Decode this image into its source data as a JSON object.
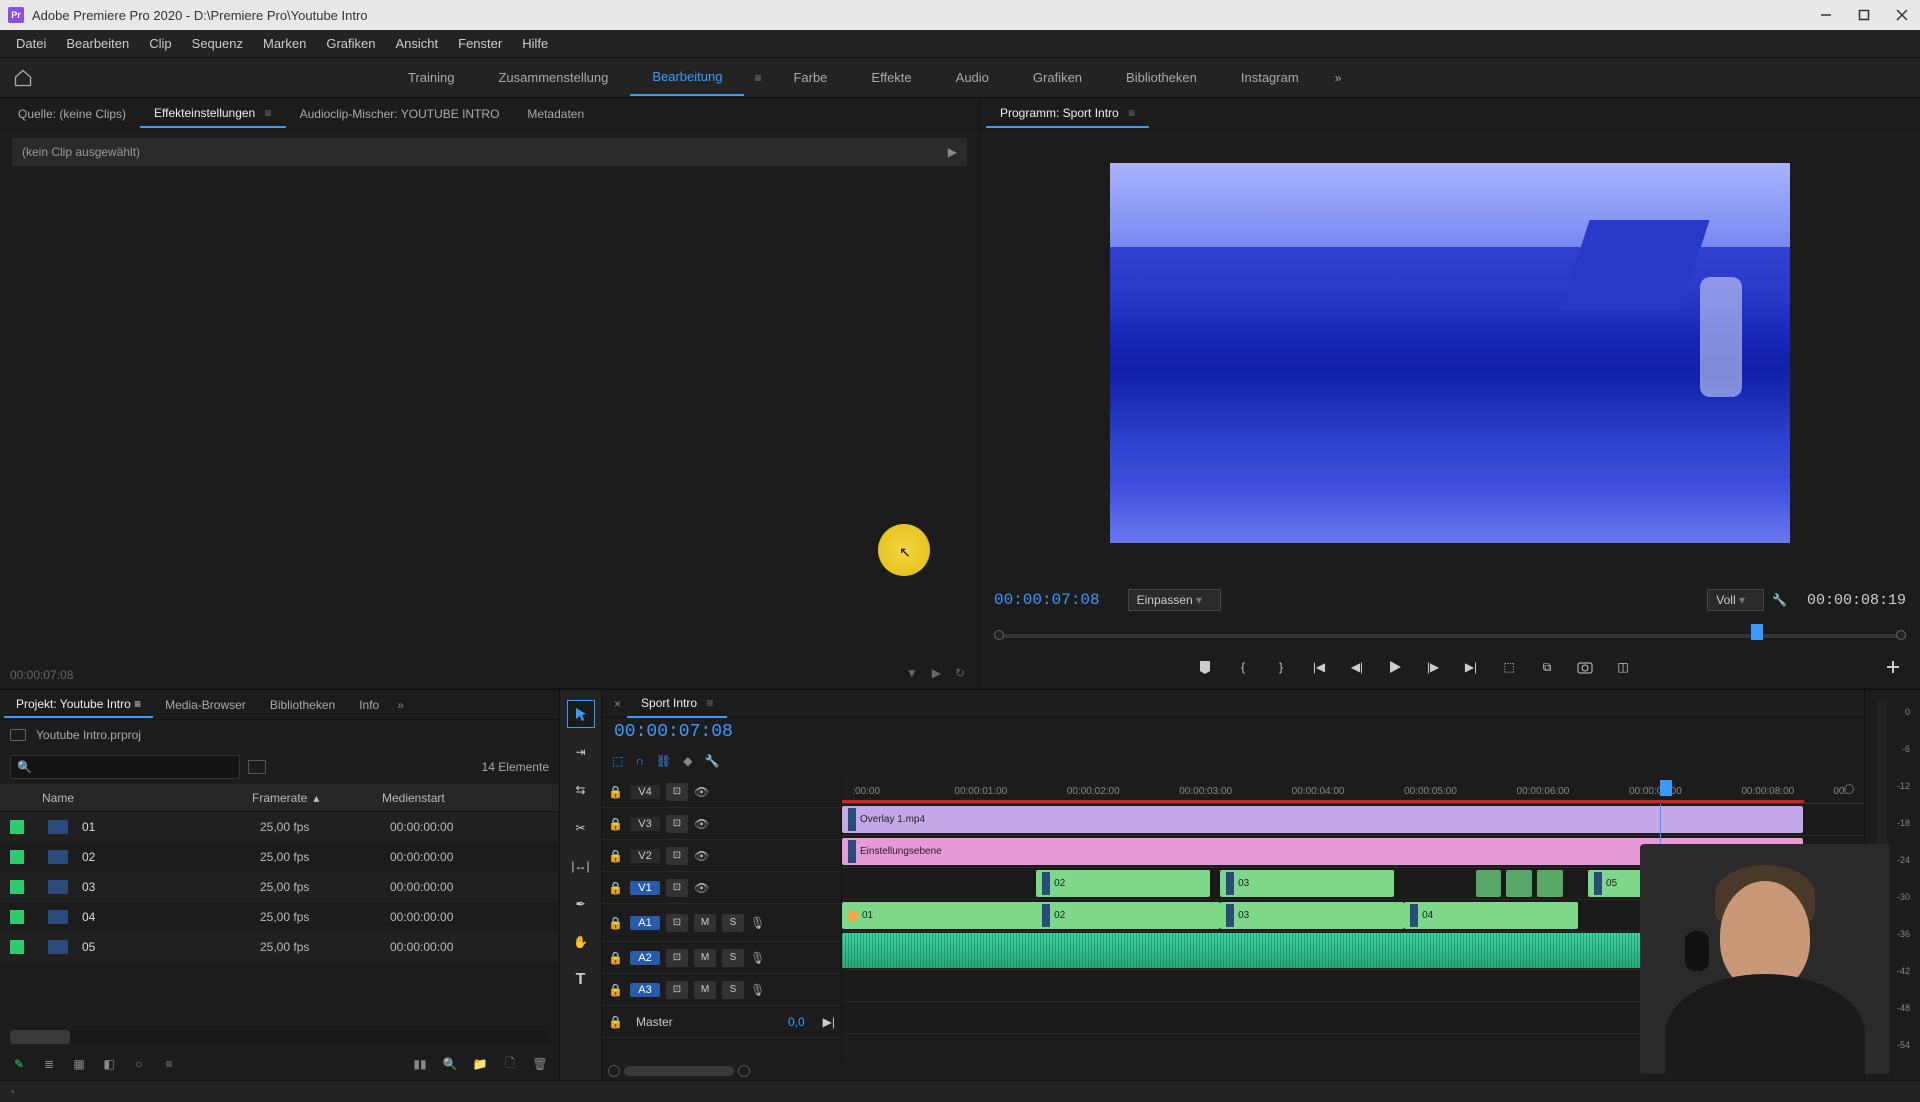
{
  "titlebar": {
    "app_initial": "Pr",
    "title": "Adobe Premiere Pro 2020 - D:\\Premiere Pro\\Youtube Intro"
  },
  "menubar": [
    "Datei",
    "Bearbeiten",
    "Clip",
    "Sequenz",
    "Marken",
    "Grafiken",
    "Ansicht",
    "Fenster",
    "Hilfe"
  ],
  "workspaces": {
    "items": [
      "Training",
      "Zusammenstellung",
      "Bearbeitung",
      "Farbe",
      "Effekte",
      "Audio",
      "Grafiken",
      "Bibliotheken",
      "Instagram"
    ],
    "active": "Bearbeitung"
  },
  "source_tabs": {
    "source": "Quelle: (keine Clips)",
    "effect": "Effekteinstellungen",
    "mixer": "Audioclip-Mischer: YOUTUBE INTRO",
    "meta": "Metadaten"
  },
  "effect_panel": {
    "no_clip": "(kein Clip ausgewählt)",
    "timecode": "00:00:07:08"
  },
  "program": {
    "tab": "Programm: Sport Intro",
    "timecode_left": "00:00:07:08",
    "fit": "Einpassen",
    "quality": "Voll",
    "timecode_right": "00:00:08:19"
  },
  "project": {
    "tabs": [
      "Projekt: Youtube Intro",
      "Media-Browser",
      "Bibliotheken",
      "Info"
    ],
    "name": "Youtube Intro.prproj",
    "count": "14 Elemente",
    "columns": {
      "name": "Name",
      "framerate": "Framerate",
      "mediastart": "Medienstart"
    },
    "rows": [
      {
        "name": "01",
        "fr": "25,00 fps",
        "ms": "00:00:00:00"
      },
      {
        "name": "02",
        "fr": "25,00 fps",
        "ms": "00:00:00:00"
      },
      {
        "name": "03",
        "fr": "25,00 fps",
        "ms": "00:00:00:00"
      },
      {
        "name": "04",
        "fr": "25,00 fps",
        "ms": "00:00:00:00"
      },
      {
        "name": "05",
        "fr": "25,00 fps",
        "ms": "00:00:00:00"
      }
    ]
  },
  "timeline": {
    "tab": "Sport Intro",
    "timecode": "00:00:07:08",
    "ruler": [
      ":00:00",
      "00:00:01:00",
      "00:00:02:00",
      "00:00:03:00",
      "00:00:04:00",
      "00:00:05:00",
      "00:00:06:00",
      "00:00:07:00",
      "00:00:08:00",
      "00:"
    ],
    "tracks": {
      "v4": "V4",
      "v3": "V3",
      "v2": "V2",
      "v1": "V1",
      "a1": "A1",
      "a2": "A2",
      "a3": "A3",
      "master": "Master",
      "master_val": "0,0",
      "m": "M",
      "s": "S"
    },
    "clips": {
      "overlay": "Overlay 1.mp4",
      "adjust": "Einstellungsebene",
      "c01": "01",
      "c02": "02",
      "c03": "03",
      "c04": "04",
      "c05": "05"
    }
  },
  "meters": {
    "ticks": [
      "0",
      "-6",
      "-12",
      "-18",
      "-24",
      "-30",
      "-36",
      "-42",
      "-48",
      "-54"
    ]
  }
}
